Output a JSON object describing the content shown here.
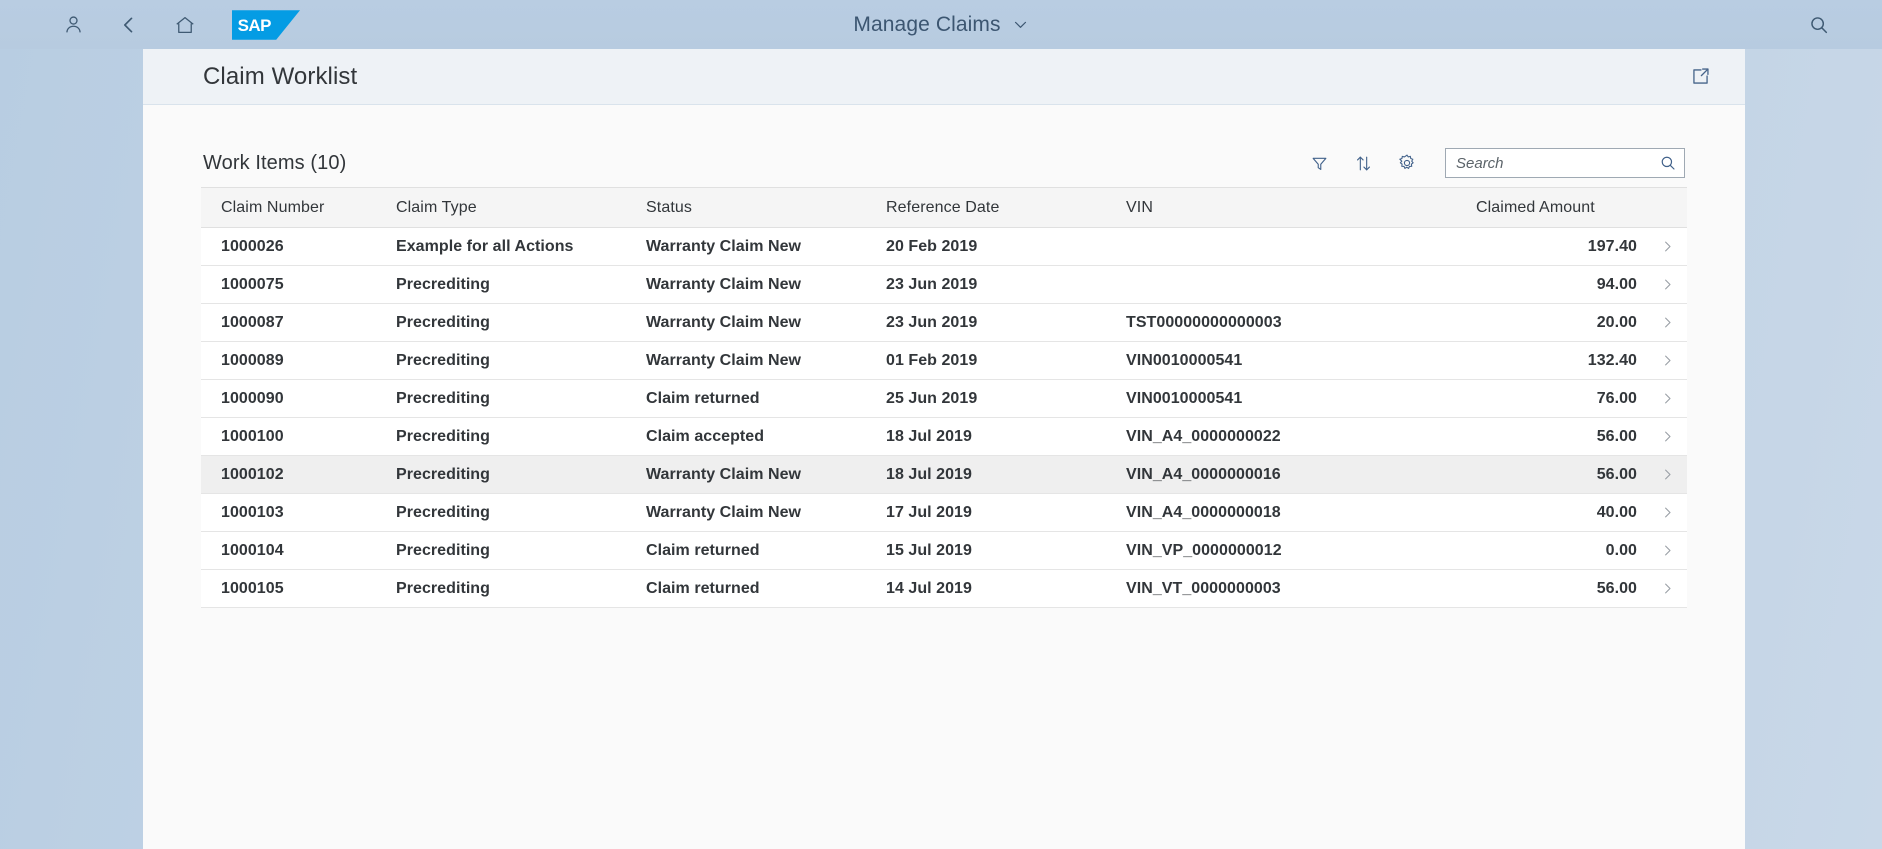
{
  "shellbar": {
    "user_icon": "user-icon",
    "back_icon": "back-chevron-icon",
    "home_icon": "home-icon",
    "logo_text": "SAP",
    "app_title": "Manage Claims",
    "title_chevron_icon": "chevron-down-icon",
    "search_icon": "search-icon"
  },
  "page": {
    "title": "Claim Worklist",
    "share_icon": "share-export-icon"
  },
  "table_toolbar": {
    "title": "Work Items (10)",
    "filter_icon": "filter-funnel-icon",
    "sort_icon": "sort-arrows-icon",
    "settings_icon": "gear-icon",
    "search_placeholder": "Search",
    "search_value": "",
    "search_icon": "search-icon"
  },
  "table": {
    "columns": [
      "Claim Number",
      "Claim Type",
      "Status",
      "Reference Date",
      "VIN",
      "Claimed Amount"
    ],
    "rows": [
      {
        "claim_number": "1000026",
        "claim_type": "Example for all Actions",
        "status": "Warranty Claim New",
        "status_state": "neutral",
        "reference_date": "20 Feb 2019",
        "vin": "",
        "claimed_amount": "197.40",
        "selected": false
      },
      {
        "claim_number": "1000075",
        "claim_type": "Precrediting",
        "status": "Warranty Claim New",
        "status_state": "neutral",
        "reference_date": "23 Jun 2019",
        "vin": "",
        "claimed_amount": "94.00",
        "selected": false
      },
      {
        "claim_number": "1000087",
        "claim_type": "Precrediting",
        "status": "Warranty Claim New",
        "status_state": "neutral",
        "reference_date": "23 Jun 2019",
        "vin": "TST00000000000003",
        "claimed_amount": "20.00",
        "selected": false
      },
      {
        "claim_number": "1000089",
        "claim_type": "Precrediting",
        "status": "Warranty Claim New",
        "status_state": "neutral",
        "reference_date": "01 Feb 2019",
        "vin": "VIN0010000541",
        "claimed_amount": "132.40",
        "selected": false
      },
      {
        "claim_number": "1000090",
        "claim_type": "Precrediting",
        "status": "Claim returned",
        "status_state": "warning",
        "reference_date": "25 Jun 2019",
        "vin": "VIN0010000541",
        "claimed_amount": "76.00",
        "selected": false
      },
      {
        "claim_number": "1000100",
        "claim_type": "Precrediting",
        "status": "Claim accepted",
        "status_state": "success",
        "reference_date": "18 Jul 2019",
        "vin": "VIN_A4_0000000022",
        "claimed_amount": "56.00",
        "selected": false
      },
      {
        "claim_number": "1000102",
        "claim_type": "Precrediting",
        "status": "Warranty Claim New",
        "status_state": "neutral",
        "reference_date": "18 Jul 2019",
        "vin": "VIN_A4_0000000016",
        "claimed_amount": "56.00",
        "selected": true
      },
      {
        "claim_number": "1000103",
        "claim_type": "Precrediting",
        "status": "Warranty Claim New",
        "status_state": "neutral",
        "reference_date": "17 Jul 2019",
        "vin": "VIN_A4_0000000018",
        "claimed_amount": "40.00",
        "selected": false
      },
      {
        "claim_number": "1000104",
        "claim_type": "Precrediting",
        "status": "Claim returned",
        "status_state": "warning",
        "reference_date": "15 Jul 2019",
        "vin": "VIN_VP_0000000012",
        "claimed_amount": "0.00",
        "selected": false
      },
      {
        "claim_number": "1000105",
        "claim_type": "Precrediting",
        "status": "Claim returned",
        "status_state": "warning",
        "reference_date": "14 Jul 2019",
        "vin": "VIN_VT_0000000003",
        "claimed_amount": "56.00",
        "selected": false
      }
    ],
    "row_nav_icon": "chevron-right-icon"
  },
  "colors": {
    "brand_blue": "#049ce4",
    "shell_bg": "#b8cce1",
    "status_warning": "#e9a400",
    "status_success": "#16ab54",
    "text_primary": "#32363a",
    "action_blue": "#41618a"
  }
}
